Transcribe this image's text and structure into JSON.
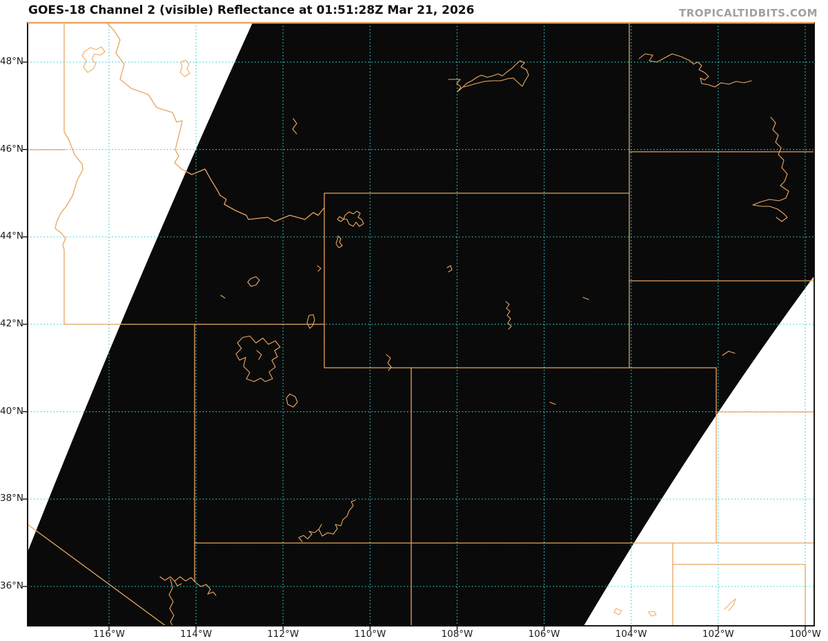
{
  "header": {
    "title": "GOES-18 Channel 2 (visible) Reflectance at 01:51:28Z Mar 21, 2026",
    "watermark": "TROPICALTIDBITS.COM"
  },
  "map": {
    "x_axis": [
      {
        "label": "116°W",
        "lon": -116
      },
      {
        "label": "114°W",
        "lon": -114
      },
      {
        "label": "112°W",
        "lon": -112
      },
      {
        "label": "110°W",
        "lon": -110
      },
      {
        "label": "108°W",
        "lon": -108
      },
      {
        "label": "106°W",
        "lon": -106
      },
      {
        "label": "104°W",
        "lon": -104
      },
      {
        "label": "102°W",
        "lon": -102
      },
      {
        "label": "100°W",
        "lon": -100
      }
    ],
    "y_axis": [
      {
        "label": "48°N",
        "lat": 48
      },
      {
        "label": "46°N",
        "lat": 46
      },
      {
        "label": "44°N",
        "lat": 44
      },
      {
        "label": "42°N",
        "lat": 42
      },
      {
        "label": "40°N",
        "lat": 40
      },
      {
        "label": "38°N",
        "lat": 38
      },
      {
        "label": "36°N",
        "lat": 36
      }
    ],
    "no_data_regions": [
      "upper-left scan edge",
      "lower-right scan edge"
    ]
  },
  "colors": {
    "map_background": "#070707",
    "scanline": "#161616",
    "gridline": "#2bd4d6",
    "land_border": "#e8a55e",
    "water": "#eeab63",
    "frame": "#000000",
    "page_background": "#ffffff",
    "title_text": "#0f0f0f",
    "axis_text": "#1a1a1a",
    "watermark_text": "#a0a0a0"
  }
}
